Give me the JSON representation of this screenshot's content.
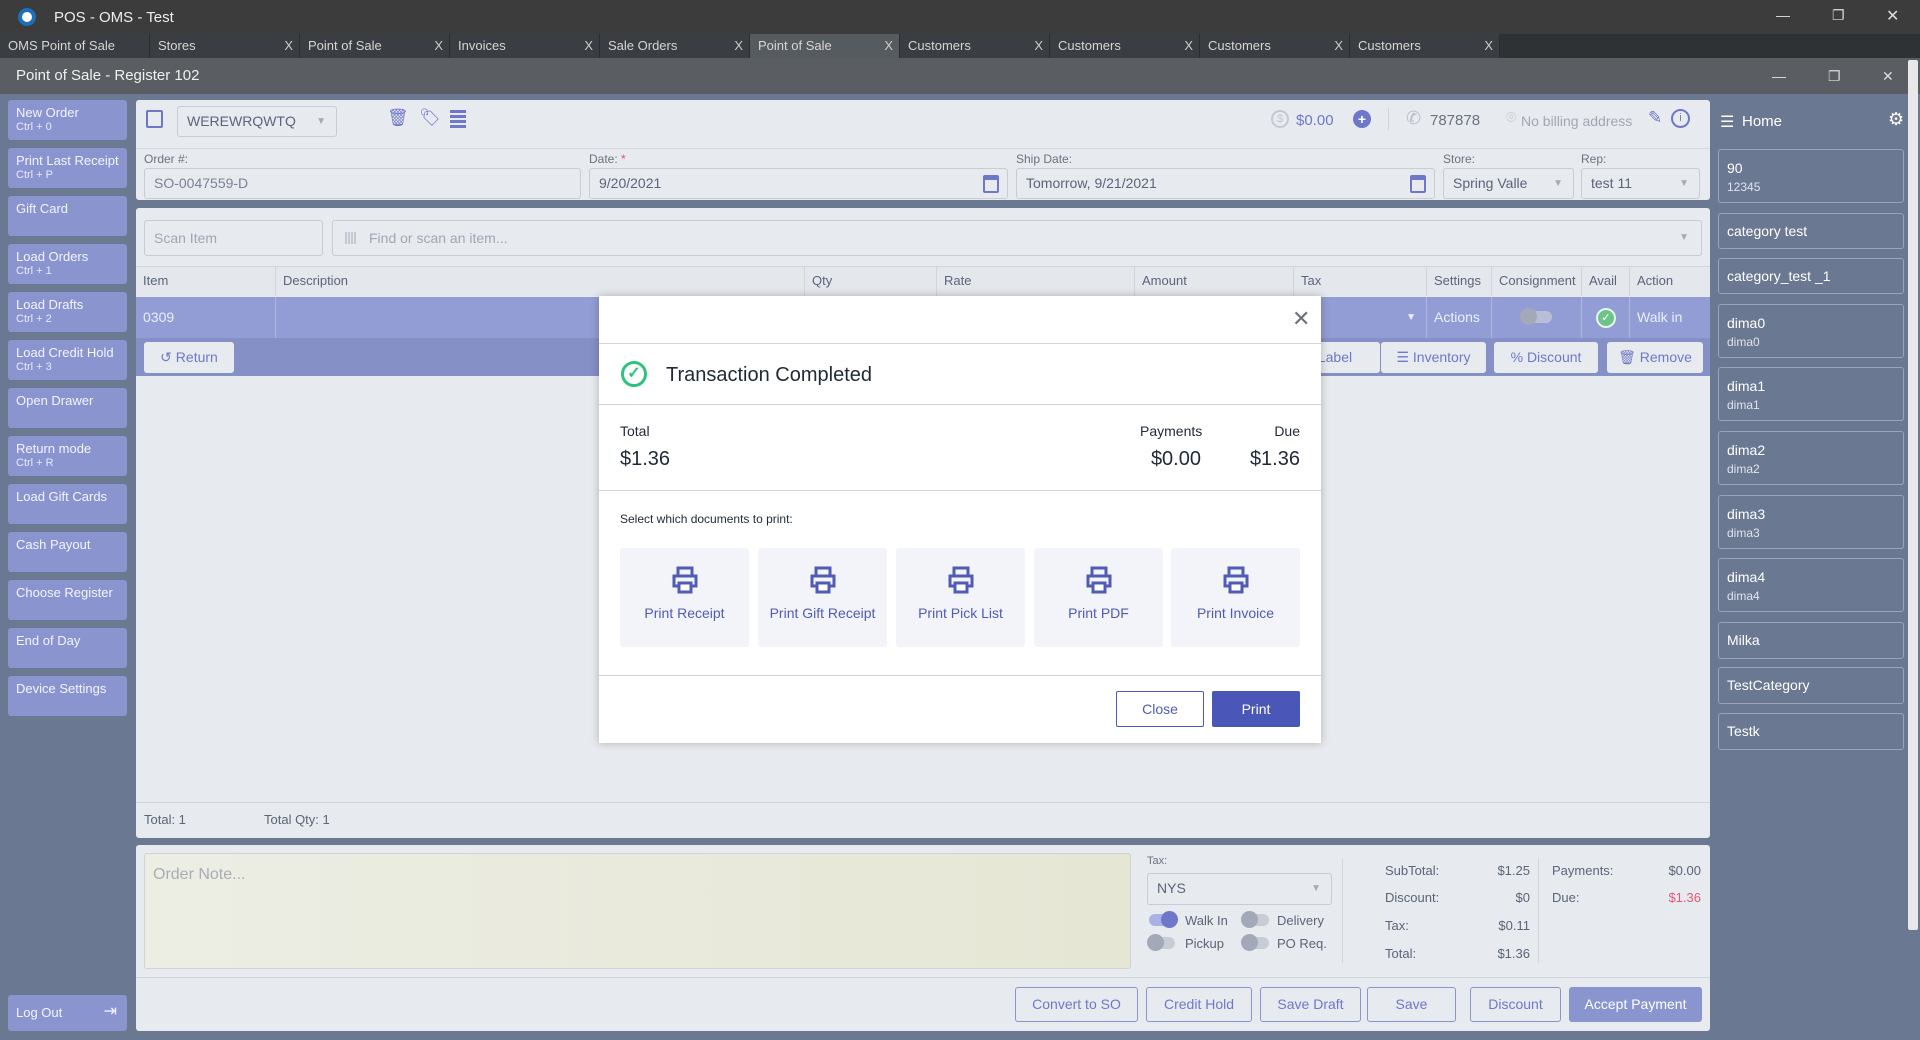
{
  "app": {
    "title": "POS - OMS - Test"
  },
  "tabs": [
    {
      "label": "OMS Point of Sale"
    },
    {
      "label": "Stores"
    },
    {
      "label": "Point of Sale"
    },
    {
      "label": "Invoices"
    },
    {
      "label": "Sale Orders"
    },
    {
      "label": "Point of Sale",
      "active": true
    },
    {
      "label": "Customers"
    },
    {
      "label": "Customers"
    },
    {
      "label": "Customers"
    },
    {
      "label": "Customers"
    }
  ],
  "tab_close": "X",
  "window": {
    "title": "Point of Sale - Register 102"
  },
  "sidebar": {
    "items": [
      {
        "label": "New Order",
        "shortcut": "Ctrl + 0"
      },
      {
        "label": "Print Last Receipt",
        "shortcut": "Ctrl + P"
      },
      {
        "label": "Gift Card",
        "shortcut": ""
      },
      {
        "label": "Load Orders",
        "shortcut": "Ctrl + 1"
      },
      {
        "label": "Load Drafts",
        "shortcut": "Ctrl + 2"
      },
      {
        "label": "Load Credit Hold",
        "shortcut": "Ctrl + 3"
      },
      {
        "label": "Open Drawer",
        "shortcut": ""
      },
      {
        "label": "Return mode",
        "shortcut": "Ctrl + R"
      },
      {
        "label": "Load Gift Cards",
        "shortcut": ""
      },
      {
        "label": "Cash Payout",
        "shortcut": ""
      },
      {
        "label": "Choose Register",
        "shortcut": ""
      },
      {
        "label": "End of Day",
        "shortcut": ""
      },
      {
        "label": "Device Settings",
        "shortcut": ""
      }
    ],
    "logout": "Log Out"
  },
  "header": {
    "customer": "WEREWRQWTQ",
    "balance": "$0.00",
    "phone": "787878",
    "billing": "No billing address"
  },
  "order": {
    "order_label": "Order #:",
    "order_value": "SO-0047559-D",
    "date_label": "Date:",
    "required": "*",
    "date_value": "9/20/2021",
    "ship_label": "Ship Date:",
    "ship_value": "Tomorrow, 9/21/2021",
    "store_label": "Store:",
    "store_value": "Spring Valle",
    "rep_label": "Rep:",
    "rep_value": "test 11"
  },
  "scan": {
    "placeholder": "Scan Item",
    "search_placeholder": "Find or scan an item..."
  },
  "table": {
    "columns": [
      "Item",
      "Description",
      "Qty",
      "Rate",
      "Amount",
      "Tax",
      "Settings",
      "Consignment",
      "Avail",
      "Action"
    ],
    "row": {
      "item": "0309",
      "settings": "Actions",
      "action": "Walk in"
    },
    "row_buttons": {
      "return": "Return",
      "label": "Label",
      "inventory": "Inventory",
      "discount": "Discount",
      "remove": "Remove"
    }
  },
  "totals_bar": {
    "total": "Total: 1",
    "total_qty": "Total Qty: 1"
  },
  "bottom": {
    "note_placeholder": "Order Note...",
    "tax_label": "Tax:",
    "tax_value": "NYS",
    "toggles": {
      "walk_in": "Walk In",
      "delivery": "Delivery",
      "pickup": "Pickup",
      "po_req": "PO Req."
    },
    "summary": {
      "subtotal_label": "SubTotal:",
      "subtotal": "$1.25",
      "discount_label": "Discount:",
      "discount": "$0",
      "tax_label": "Tax:",
      "tax": "$0.11",
      "total_label": "Total:",
      "total": "$1.36",
      "payments_label": "Payments:",
      "payments": "$0.00",
      "due_label": "Due:",
      "due": "$1.36"
    },
    "buttons": {
      "convert": "Convert to SO",
      "credit_hold": "Credit Hold",
      "save_draft": "Save Draft",
      "save": "Save",
      "discount": "Discount",
      "accept": "Accept Payment"
    }
  },
  "right": {
    "title": "Home",
    "items": [
      {
        "label": "90",
        "sub": "12345"
      },
      {
        "label": "category test",
        "sub": ""
      },
      {
        "label": "category_test _1",
        "sub": ""
      },
      {
        "label": "dima0",
        "sub": "dima0"
      },
      {
        "label": "dima1",
        "sub": "dima1"
      },
      {
        "label": "dima2",
        "sub": "dima2"
      },
      {
        "label": "dima3",
        "sub": "dima3"
      },
      {
        "label": "dima4",
        "sub": "dima4"
      },
      {
        "label": "Milka",
        "sub": ""
      },
      {
        "label": "TestCategory",
        "sub": ""
      },
      {
        "label": "Testk",
        "sub": ""
      }
    ]
  },
  "modal": {
    "title": "Transaction Completed",
    "total_label": "Total",
    "total": "$1.36",
    "payments_label": "Payments",
    "payments": "$0.00",
    "due_label": "Due",
    "due": "$1.36",
    "select_label": "Select which documents to print:",
    "docs": [
      "Print Receipt",
      "Print Gift Receipt",
      "Print Pick List",
      "Print PDF",
      "Print Invoice"
    ],
    "close": "Close",
    "print": "Print"
  },
  "colors": {
    "accent": "#6f78c8",
    "primary_btn": "#4a56b8",
    "due": "#e05a7a",
    "success": "#2ec27e"
  }
}
